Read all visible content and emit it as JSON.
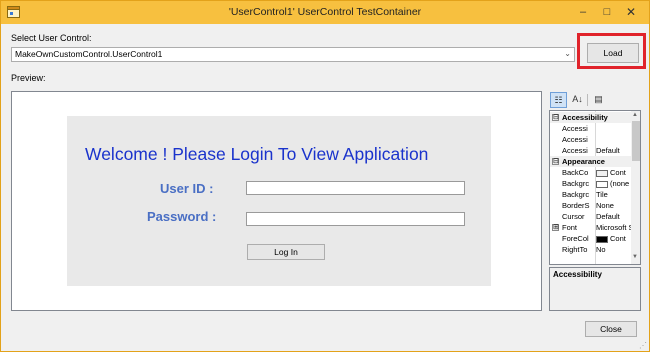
{
  "window": {
    "title": "'UserControl1' UserControl TestContainer",
    "icon": "app-icon",
    "min_glyph": "–",
    "max_glyph": "□",
    "close_glyph": "✕"
  },
  "select": {
    "label": "Select User Control:",
    "value": "MakeOwnCustomControl.UserControl1",
    "arrow": "⌄"
  },
  "load_button": "Load",
  "preview": {
    "label": "Preview:",
    "welcome": "Welcome ! Please Login To View Application",
    "user_label": "User ID :",
    "password_label": "Password :",
    "user_value": "",
    "password_value": "",
    "login_button": "Log In"
  },
  "property_grid": {
    "toolbar": {
      "categorized": "☷",
      "alphabetical": "A↓",
      "pages": "▤"
    },
    "rows": [
      {
        "type": "category",
        "expander": "⊟",
        "name": "Accessibility"
      },
      {
        "type": "prop",
        "name": "Accessi",
        "value": ""
      },
      {
        "type": "prop",
        "name": "Accessi",
        "value": ""
      },
      {
        "type": "prop",
        "name": "Accessi",
        "value": "Default"
      },
      {
        "type": "category",
        "expander": "⊟",
        "name": "Appearance"
      },
      {
        "type": "prop",
        "name": "BackCo",
        "value": "Cont",
        "swatch": "#f0f0f0"
      },
      {
        "type": "prop",
        "name": "Backgrc",
        "value": "(none",
        "swatch": "#ffffff"
      },
      {
        "type": "prop",
        "name": "Backgrc",
        "value": "Tile"
      },
      {
        "type": "prop",
        "name": "BorderS",
        "value": "None"
      },
      {
        "type": "prop",
        "name": "Cursor",
        "value": "Default"
      },
      {
        "type": "prop",
        "name": "Font",
        "value": "Microsoft S",
        "expander": "⊞"
      },
      {
        "type": "prop",
        "name": "ForeCol",
        "value": "Cont",
        "swatch": "#000000"
      },
      {
        "type": "prop",
        "name": "RightTo",
        "value": "No"
      }
    ],
    "description_title": "Accessibility"
  },
  "close_button": "Close",
  "colors": {
    "title_bar": "#f7c03f",
    "highlight": "#e0232b",
    "welcome_text": "#1a33cc",
    "field_label": "#4a6fc4"
  }
}
